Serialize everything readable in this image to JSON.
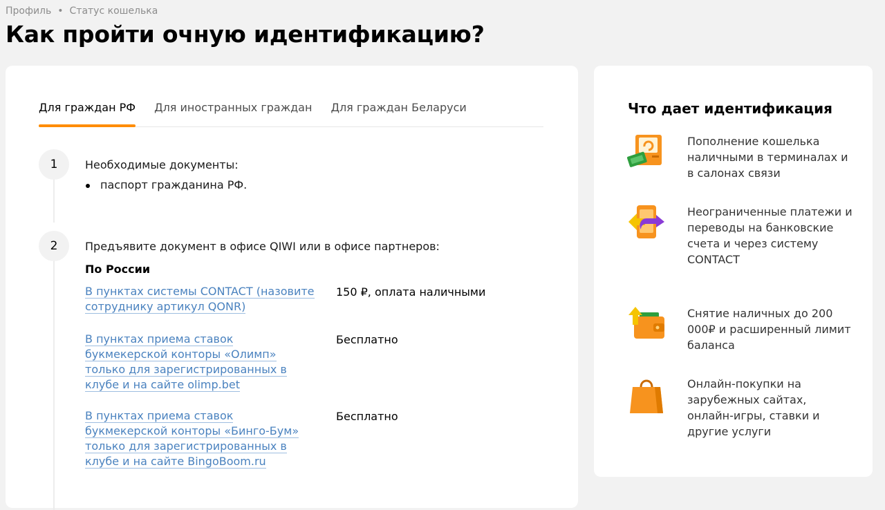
{
  "breadcrumb": {
    "items": [
      "Профиль",
      "Статус кошелька"
    ],
    "separator": "•"
  },
  "page_title": "Как пройти очную идентификацию?",
  "tabs": [
    {
      "label": "Для граждан РФ",
      "active": true
    },
    {
      "label": "Для иностранных граждан",
      "active": false
    },
    {
      "label": "Для граждан Беларуси",
      "active": false
    }
  ],
  "steps": [
    {
      "number": "1",
      "title": "Необходимые документы:",
      "bullets": [
        "паспорт гражданина РФ."
      ]
    },
    {
      "number": "2",
      "title": "Предъявите документ в офисе QIWI или в офисе партнеров:",
      "subheading": "По России",
      "partners": [
        {
          "link": "В пунктах системы CONTACT (назовите сотруднику артикул QONR)",
          "price": "150 ₽, оплата наличными"
        },
        {
          "link": "В пунктах приема ставок букмекерской конторы «Олимп» только для зарегистрированных в клубе и на сайте olimp.bet",
          "price": "Бесплатно"
        },
        {
          "link": "В пунктах приема ставок букмекерской конторы «Бинго-Бум» только для зарегистрированных в клубе и на сайте BingoBoom.ru",
          "price": "Бесплатно"
        }
      ]
    }
  ],
  "sidebar": {
    "title": "Что дает идентификация",
    "benefits": [
      {
        "icon": "terminal-icon",
        "text": "Пополнение кошелька наличными в терминалах и в салонах связи"
      },
      {
        "icon": "phone-transfer-icon",
        "text": "Неограниченные платежи и переводы на банковские счета и через систему CONTACT"
      },
      {
        "icon": "wallet-icon",
        "text": "Снятие наличных до 200 000₽ и расширенный лимит баланса"
      },
      {
        "icon": "shopping-bag-icon",
        "text": "Онлайн-покупки на зарубежных сайтах, онлайн-игры, ставки и другие услуги"
      }
    ]
  },
  "colors": {
    "accent": "#ff8c00",
    "link": "#4a82bf",
    "background": "#f2f2f2",
    "card": "#ffffff"
  }
}
